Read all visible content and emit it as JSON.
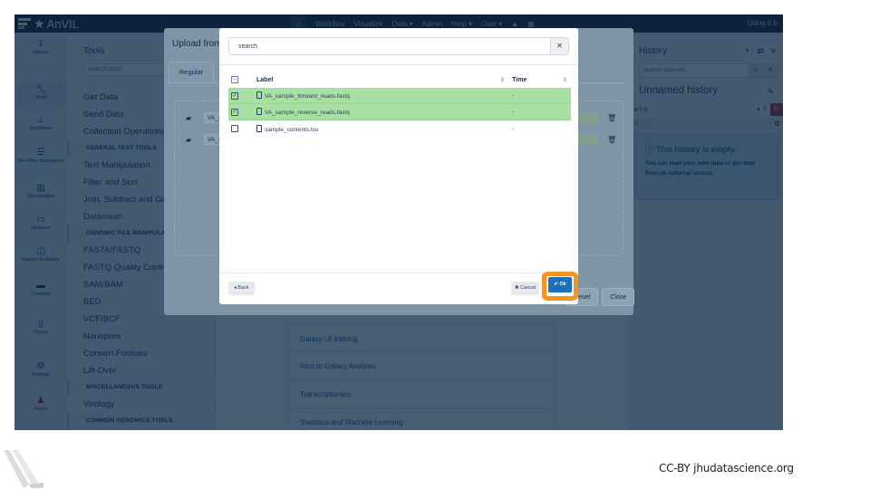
{
  "navbar": {
    "brand": "AnVIL",
    "items": [
      "Workflow",
      "Visualize",
      "Data ▾",
      "Admin",
      "Help ▾",
      "User ▾"
    ],
    "using": "Using 0 b"
  },
  "rail": {
    "items": [
      {
        "label": "Upload",
        "icon": "upload-icon",
        "glyph": "⇪"
      },
      {
        "label": "Tools",
        "icon": "wrench-icon",
        "glyph": "🔧"
      },
      {
        "label": "Workflows",
        "icon": "sitemap-icon",
        "glyph": "⊥"
      },
      {
        "label": "Workflow Invocations",
        "icon": "list-icon",
        "glyph": "☰"
      },
      {
        "label": "Visualization",
        "icon": "chart-icon",
        "glyph": "▥"
      },
      {
        "label": "Histories",
        "icon": "hdd-icon",
        "glyph": "▭"
      },
      {
        "label": "History Multiview",
        "icon": "columns-icon",
        "glyph": "◫"
      },
      {
        "label": "Datasets",
        "icon": "folder-icon",
        "glyph": "▬"
      },
      {
        "label": "Pages",
        "icon": "file-icon",
        "glyph": "▯"
      },
      {
        "label": "Settings",
        "icon": "gear-icon",
        "glyph": "⚙"
      },
      {
        "label": "Admin",
        "icon": "user-cog-icon",
        "glyph": "♟"
      }
    ]
  },
  "tools": {
    "title": "Tools",
    "search_placeholder": "search tools",
    "list": [
      {
        "type": "item",
        "label": "Get Data"
      },
      {
        "type": "item",
        "label": "Send Data"
      },
      {
        "type": "item",
        "label": "Collection Operations"
      },
      {
        "type": "section",
        "label": "GENERAL TEXT TOOLS"
      },
      {
        "type": "item",
        "label": "Text Manipulation"
      },
      {
        "type": "item",
        "label": "Filter and Sort"
      },
      {
        "type": "item",
        "label": "Join, Subtract and Group"
      },
      {
        "type": "item",
        "label": "Datamash"
      },
      {
        "type": "section",
        "label": "GENOMIC FILE MANIPULATION"
      },
      {
        "type": "item",
        "label": "FASTA/FASTQ"
      },
      {
        "type": "item",
        "label": "FASTQ Quality Control"
      },
      {
        "type": "item",
        "label": "SAM/BAM"
      },
      {
        "type": "item",
        "label": "BED"
      },
      {
        "type": "item",
        "label": "VCF/BCF"
      },
      {
        "type": "item",
        "label": "Nanopore"
      },
      {
        "type": "item",
        "label": "Convert Formats"
      },
      {
        "type": "item",
        "label": "Lift-Over"
      },
      {
        "type": "section",
        "label": "MISCELLANEOUS TOOLS"
      },
      {
        "type": "item",
        "label": "Virology"
      },
      {
        "type": "section",
        "label": "COMMON GENOMICS TOOLS"
      }
    ]
  },
  "center": {
    "help_items": [
      "Galaxy UI training",
      "Intro to Galaxy Analysis",
      "Transcriptomics",
      "Statistics and Machine Learning"
    ]
  },
  "history": {
    "title": "History",
    "search_placeholder": "search datasets",
    "name": "Unnamed history",
    "size": "0 B",
    "badge_count": "0",
    "empty_title": "This history is empty.",
    "empty_body": "You can load your own data or get data from an external source."
  },
  "upload_dialog": {
    "title": "Upload from",
    "tab": "Regular",
    "rows": [
      "VA_sample_forward_reads.fastq",
      "VA_sample_reverse_reads.fastq"
    ],
    "buttons": [
      "Reset",
      "Close"
    ]
  },
  "picker": {
    "search_value": "search",
    "columns": {
      "label": "Label",
      "time": "Time"
    },
    "rows": [
      {
        "label": "VA_sample_forward_reads.fastq",
        "time": "-",
        "checked": true
      },
      {
        "label": "VA_sample_reverse_reads.fastq",
        "time": "-",
        "checked": true
      },
      {
        "label": "sample_contents.tsv",
        "time": "-",
        "checked": false
      }
    ],
    "back_label": "◂ Back",
    "cancel_label": "✖ Cancel",
    "ok_label": "✔ Ok",
    "highlight_color": "#f7941d"
  },
  "footer": {
    "credit": "CC-BY  jhudatascience.org"
  }
}
